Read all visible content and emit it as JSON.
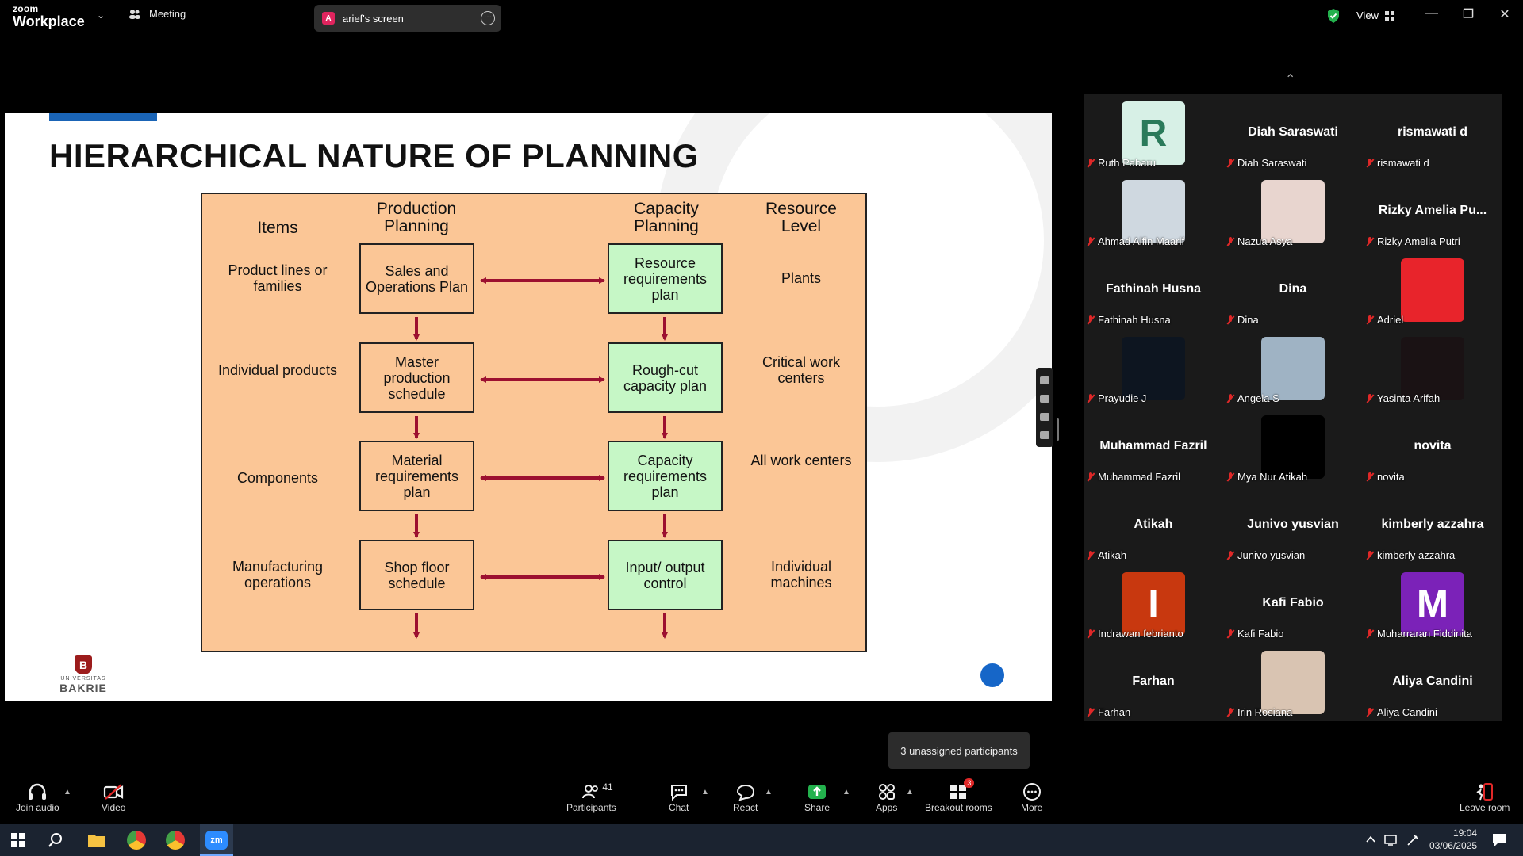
{
  "topbar": {
    "logo_line1": "zoom",
    "logo_line2": "Workplace",
    "meeting_label": "Meeting",
    "share_badge": "A",
    "share_label": "arief's screen",
    "view_label": "View"
  },
  "slide": {
    "title": "HIERARCHICAL NATURE OF PLANNING",
    "logo_small": "UNIVERSITAS",
    "logo_big": "BAKRIE",
    "diagram": {
      "headers": {
        "items": "Items",
        "production": "Production Planning",
        "capacity": "Capacity Planning",
        "resource": "Resource Level"
      },
      "rows": [
        {
          "item": "Product lines or families",
          "production": "Sales and Operations Plan",
          "capacity": "Resource requirements plan",
          "resource": "Plants"
        },
        {
          "item": "Individual products",
          "production": "Master production schedule",
          "capacity": "Rough-cut capacity plan",
          "resource": "Critical work centers"
        },
        {
          "item": "Components",
          "production": "Material requirements plan",
          "capacity": "Capacity requirements plan",
          "resource": "All work centers"
        },
        {
          "item": "Manufacturing operations",
          "production": "Shop floor schedule",
          "capacity": "Input/ output control",
          "resource": "Individual machines"
        }
      ]
    }
  },
  "gallery": {
    "tiles": [
      {
        "caption": "Ruth Pabaru",
        "avatar": "R",
        "avatar_color": "#d7f0e6",
        "avatar_text_color": "#2a7a5a"
      },
      {
        "caption": "Diah Saraswati",
        "big": "Diah Saraswati"
      },
      {
        "caption": "rismawati d",
        "big": "rismawati d"
      },
      {
        "caption": "Ahmad Alfin Maarif",
        "photo": "#cfd8e0"
      },
      {
        "caption": "Nazua Asya",
        "photo": "#e8d5cf"
      },
      {
        "caption": "Rizky Amelia Putri",
        "big": "Rizky Amelia Pu..."
      },
      {
        "caption": "Fathinah Husna",
        "big": "Fathinah Husna"
      },
      {
        "caption": "Dina",
        "big": "Dina"
      },
      {
        "caption": "Adriel",
        "photo": "#e8242b"
      },
      {
        "caption": "Prayudie J",
        "photo": "#0d1520"
      },
      {
        "caption": "Angela S",
        "photo": "#9fb3c4"
      },
      {
        "caption": "Yasinta Arifah",
        "photo": "#1a1214"
      },
      {
        "caption": "Muhammad Fazril",
        "big": "Muhammad Fazril"
      },
      {
        "caption": "Mya Nur Atikah",
        "photo": "#000000"
      },
      {
        "caption": "novita",
        "big": "novita"
      },
      {
        "caption": "Atikah",
        "big": "Atikah"
      },
      {
        "caption": "Junivo yusvian",
        "big": "Junivo yusvian"
      },
      {
        "caption": "kimberly azzahra",
        "big": "kimberly azzahra"
      },
      {
        "caption": "Indrawan febrianto",
        "avatar": "I",
        "avatar_color": "#c8380f",
        "avatar_text_color": "#ffffff"
      },
      {
        "caption": "Kafi Fabio",
        "big": "Kafi Fabio"
      },
      {
        "caption": "Muharraran Fiddinita",
        "avatar": "M",
        "avatar_color": "#7b22b8",
        "avatar_text_color": "#ffffff"
      },
      {
        "caption": "Farhan",
        "big": "Farhan"
      },
      {
        "caption": "Irin Rosiana",
        "photo": "#d9c4b2"
      },
      {
        "caption": "Aliya Candini",
        "big": "Aliya Candini"
      }
    ]
  },
  "tooltip": "3 unassigned participants",
  "bottombar": {
    "join_audio": "Join audio",
    "video": "Video",
    "participants": "Participants",
    "participants_count": "41",
    "chat": "Chat",
    "react": "React",
    "share": "Share",
    "apps": "Apps",
    "breakout": "Breakout rooms",
    "breakout_count": "3",
    "more": "More",
    "leave": "Leave room"
  },
  "taskbar": {
    "time": "19:04",
    "date": "03/06/2025"
  }
}
